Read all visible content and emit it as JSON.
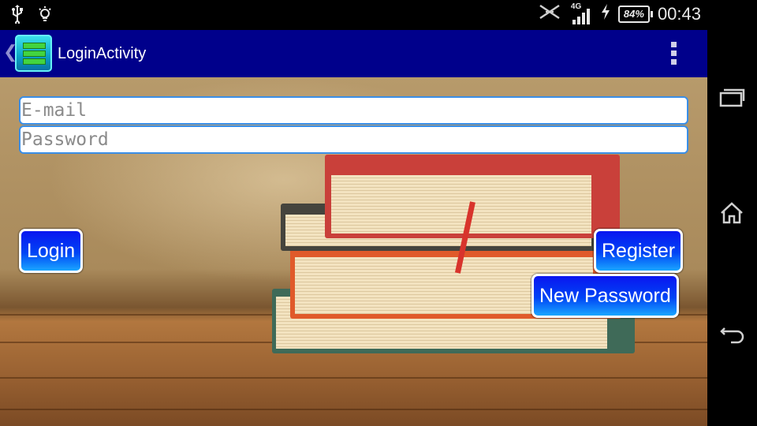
{
  "status_bar": {
    "icons_left": [
      "usb-icon",
      "lightbulb-icon"
    ],
    "icons_right": [
      "nfc-disabled-icon",
      "signal-4g-icon",
      "charging-icon"
    ],
    "network": "4G",
    "battery": "84%",
    "clock": "00:43"
  },
  "action_bar": {
    "title": "LoginActivity",
    "background": "#00008b"
  },
  "form": {
    "email_placeholder": "E-mail",
    "email_value": "",
    "password_placeholder": "Password",
    "password_value": ""
  },
  "buttons": {
    "login": "Login",
    "register": "Register",
    "new_password": "New Password"
  },
  "nav_bar": {
    "icons": [
      "recent-apps-icon",
      "home-icon",
      "back-icon"
    ]
  },
  "colors": {
    "button_blue": "#0044f5",
    "field_border": "#3a8ee6"
  }
}
